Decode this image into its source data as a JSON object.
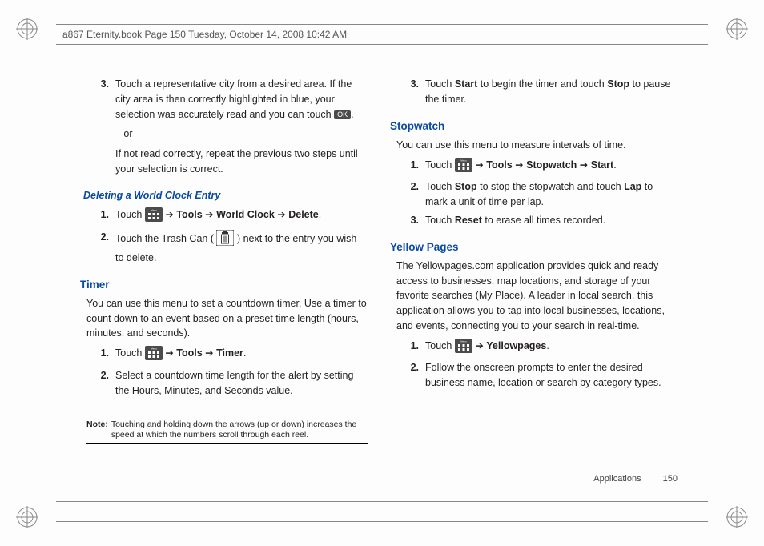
{
  "header": "a867 Eternity.book  Page 150  Tuesday, October 14, 2008  10:42 AM",
  "footer": {
    "section": "Applications",
    "page": "150"
  },
  "left": {
    "step3": {
      "num": "3.",
      "p1_a": "Touch a representative city from a desired area. If the city area is then correctly highlighted in blue, your selection was accurately read and you can touch ",
      "ok": "OK",
      "p1_b": ".",
      "p2": "– or –",
      "p3": "If not read correctly, repeat the previous two steps until your selection is correct."
    },
    "deleting": {
      "heading": "Deleting a World Clock Entry",
      "s1": {
        "num": "1.",
        "a": "Touch ",
        "b": " ➔ ",
        "c": "Tools",
        "d": " ➔ ",
        "e": "World Clock",
        "f": " ➔ ",
        "g": "Delete",
        "h": "."
      },
      "s2": {
        "num": "2.",
        "a": "Touch the Trash Can (",
        "b": ") next to the entry you wish to delete."
      }
    },
    "timer": {
      "heading": "Timer",
      "intro": "You can use this menu to set a countdown timer. Use a timer to count down to an event based on a preset time length (hours, minutes, and seconds).",
      "s1": {
        "num": "1.",
        "a": "Touch ",
        "b": " ➔ ",
        "c": "Tools",
        "d": " ➔ ",
        "e": "Timer",
        "f": "."
      },
      "s2": {
        "num": "2.",
        "txt": "Select a countdown time length for the alert by setting the Hours, Minutes, and Seconds value."
      }
    },
    "note": {
      "label": "Note:",
      "text": "Touching and holding down the arrows (up or down) increases the speed at which the numbers scroll through each reel."
    }
  },
  "right": {
    "step3": {
      "num": "3.",
      "a": "Touch ",
      "b": "Start",
      "c": " to begin the timer and touch ",
      "d": "Stop",
      "e": " to pause the timer."
    },
    "stopwatch": {
      "heading": "Stopwatch",
      "intro": "You can use this menu to measure intervals of time.",
      "s1": {
        "num": "1.",
        "a": "Touch ",
        "b": " ➔ ",
        "c": "Tools",
        "d": " ➔ ",
        "e": "Stopwatch",
        "f": " ➔ ",
        "g": "Start",
        "h": "."
      },
      "s2": {
        "num": "2.",
        "a": "Touch ",
        "b": "Stop",
        "c": " to stop the stopwatch and touch ",
        "d": "Lap",
        "e": " to mark a unit of time per lap."
      },
      "s3": {
        "num": "3.",
        "a": "Touch ",
        "b": "Reset",
        "c": " to erase all times recorded."
      }
    },
    "yellow": {
      "heading": "Yellow Pages",
      "intro": "The Yellowpages.com application provides quick and ready access to businesses, map locations, and storage of your favorite searches (My Place). A leader in local search, this application allows you to tap into local businesses, locations, and events, connecting you to your search in real-time.",
      "s1": {
        "num": "1.",
        "a": "Touch ",
        "b": " ➔ ",
        "c": "Yellowpages",
        "d": "."
      },
      "s2": {
        "num": "2.",
        "txt": "Follow the onscreen prompts to enter the desired business name, location or search by category types."
      }
    }
  }
}
